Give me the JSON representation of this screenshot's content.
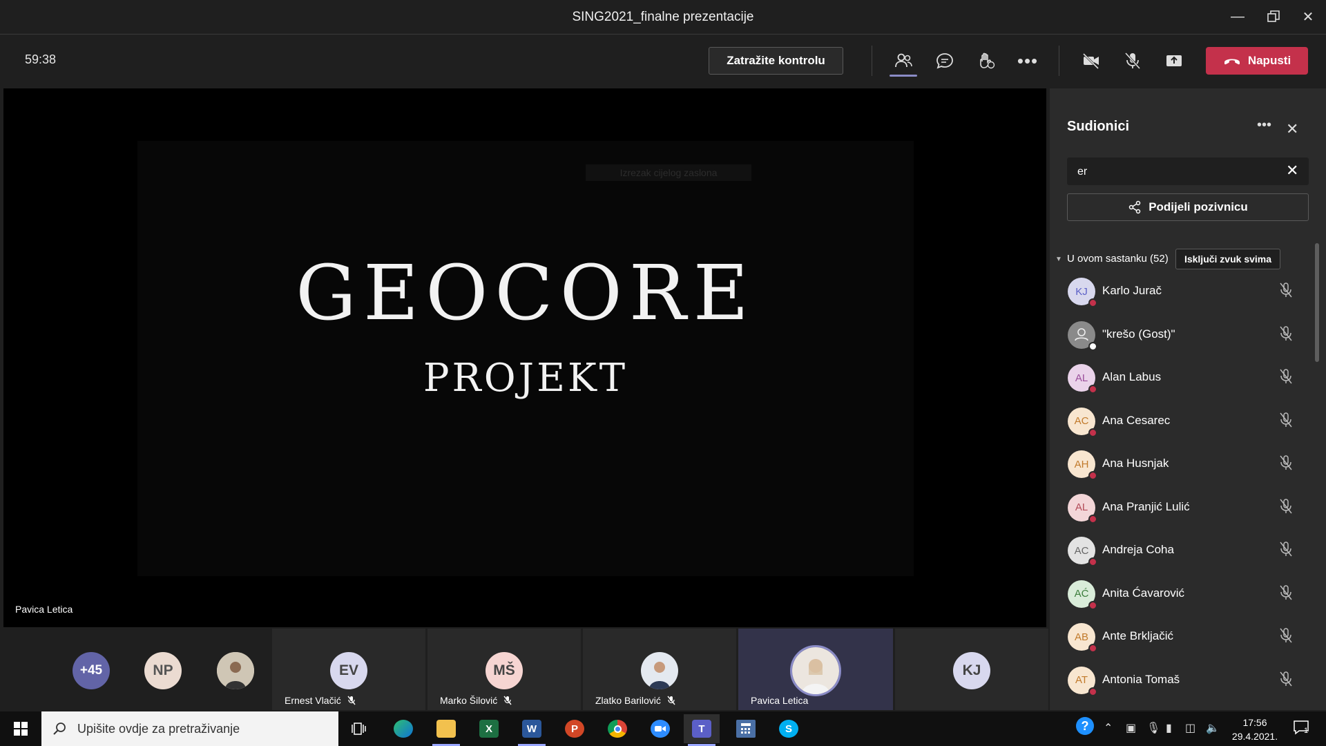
{
  "window": {
    "title": "SING2021_finalne prezentacije"
  },
  "toolbar": {
    "timer": "59:38",
    "request_control_label": "Zatražite kontrolu",
    "leave_label": "Napusti"
  },
  "stage": {
    "overlay_text": "Izrezak cijelog zaslona",
    "slide_title": "GEOCORE",
    "slide_subtitle": "PROJEKT",
    "presenter_name": "Pavica Letica"
  },
  "strip": {
    "overflow_count": "+45",
    "np_initials": "NP",
    "tiles": [
      {
        "initials": "EV",
        "name": "Ernest Vlačić",
        "color": "#d8d8ee"
      },
      {
        "initials": "MŠ",
        "name": "Marko Šilović",
        "color": "#f6d5d2"
      },
      {
        "initials": "",
        "name": "Zlatko Barilović",
        "color": "#cfd8e6"
      },
      {
        "initials": "",
        "name": "Pavica Letica",
        "color": "#e9e1da"
      },
      {
        "initials": "KJ",
        "name": "",
        "color": "#d8d8ee"
      }
    ]
  },
  "panel": {
    "title": "Sudionici",
    "search_value": "er",
    "share_invite_label": "Podijeli pozivnicu",
    "section_label": "U ovom sastanku (52)",
    "mute_all_label": "Isključi zvuk svima",
    "participants": [
      {
        "initials": "KJ",
        "name": "Karlo Jurač",
        "color": "#d8d8ee",
        "text_color": "#5b5fc7"
      },
      {
        "initials": "",
        "name": "\"krešo (Gost)\"",
        "color": "#8a8a8a",
        "text_color": "#ffffff"
      },
      {
        "initials": "AL",
        "name": "Alan Labus",
        "color": "#ead3ea",
        "text_color": "#9a4d9a"
      },
      {
        "initials": "AC",
        "name": "Ana Cesarec",
        "color": "#f8e6d0",
        "text_color": "#c17a2b"
      },
      {
        "initials": "AH",
        "name": "Ana Husnjak",
        "color": "#f8e6d0",
        "text_color": "#c17a2b"
      },
      {
        "initials": "AL",
        "name": "Ana Pranjić Lulić",
        "color": "#f3d6d8",
        "text_color": "#b24b58"
      },
      {
        "initials": "AC",
        "name": "Andreja Coha",
        "color": "#e3e3e3",
        "text_color": "#666666"
      },
      {
        "initials": "AĆ",
        "name": "Anita Ćavarović",
        "color": "#d9ecd9",
        "text_color": "#3b7d3b"
      },
      {
        "initials": "AB",
        "name": "Ante Brkljačić",
        "color": "#f8e6d0",
        "text_color": "#c17a2b"
      },
      {
        "initials": "AT",
        "name": "Antonia Tomaš",
        "color": "#f8e6d0",
        "text_color": "#c17a2b"
      }
    ]
  },
  "taskbar": {
    "search_placeholder": "Upišite ovdje za pretraživanje",
    "time": "17:56",
    "date": "29.4.2021.",
    "notification_count": "1"
  },
  "colors": {
    "leave": "#c4314b",
    "accent": "#8b8cc7",
    "status_busy": "#c4314b"
  }
}
